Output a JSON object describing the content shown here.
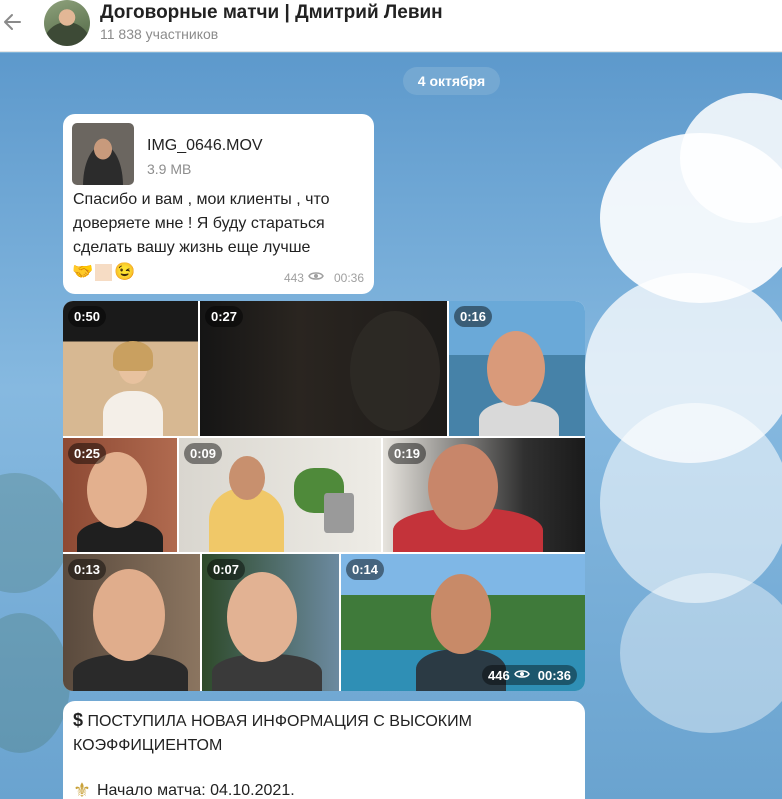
{
  "header": {
    "title": "Договорные матчи | Дмитрий Левин",
    "subtitle": "11 838 участников",
    "back_icon": "arrow-left-icon"
  },
  "chat": {
    "date_label": "4 октября",
    "message_video_file": {
      "file_name": "IMG_0646.MOV",
      "file_size": "3.9 MB",
      "text": "Спасибо и вам , мои клиенты , что доверяете мне ! Я буду стараться сделать вашу жизнь еще лучше",
      "emojis": [
        "🤝",
        "🏼",
        "😉"
      ],
      "views": "443",
      "time": "00:36"
    },
    "album": {
      "videos": [
        {
          "duration": "0:50"
        },
        {
          "duration": "0:27"
        },
        {
          "duration": "0:16"
        },
        {
          "duration": "0:25"
        },
        {
          "duration": "0:09"
        },
        {
          "duration": "0:19"
        },
        {
          "duration": "0:13"
        },
        {
          "duration": "0:07"
        },
        {
          "duration": "0:14"
        }
      ],
      "views": "446",
      "time": "00:36"
    },
    "message_info": {
      "icon": "dollar-sign-emoji",
      "headline": "ПОСТУПИЛА НОВАЯ ИНФОРМАЦИЯ С ВЫСОКИМ КОЭФФИЦИЕНТОМ",
      "match_icon": "fleur-de-lis-emoji",
      "match_start": "Начало матча: 04.10.2021."
    }
  },
  "colors": {
    "header_bg": "#ffffff",
    "bubble_bg": "#ffffff",
    "date_pill": "#78aad2",
    "muted_text": "#8b8b8b"
  }
}
